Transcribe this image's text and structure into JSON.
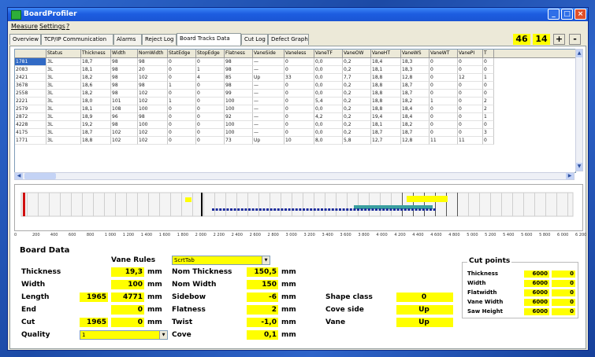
{
  "window": {
    "title": "BoardProfiler",
    "accent": "#1d5de0"
  },
  "menu": [
    "Measure",
    "Settings",
    "?"
  ],
  "tabs": [
    "Overview",
    "TCP/IP Communication",
    "Alarms",
    "Reject Log",
    "Board Tracks Data",
    "Cut Log",
    "Defect Graph"
  ],
  "active_tab": 4,
  "counters": {
    "a": "46",
    "b": "14"
  },
  "buttons": {
    "plus": "+",
    "minus": "-"
  },
  "grid": {
    "columns": [
      "",
      "Status",
      "Thickness",
      "Width",
      "NomWidth",
      "StatEdge",
      "StopEdge",
      "Flatness",
      "VaneSide",
      "Vaneless",
      "VaneTF",
      "VaneOW",
      "VaneHT",
      "VaneWS",
      "VaneWT",
      "VanePI",
      "T"
    ],
    "rows": [
      [
        "1781",
        "3L",
        "18,7",
        "98",
        "98",
        "0",
        "0",
        "98",
        "—",
        "0",
        "0,0",
        "0,2",
        "18,4",
        "18,3",
        "0",
        "0",
        "0"
      ],
      [
        "2083",
        "3L",
        "18,1",
        "98",
        "20",
        "0",
        "1",
        "98",
        "—",
        "0",
        "0,0",
        "0,2",
        "18,1",
        "18,3",
        "0",
        "0",
        "0"
      ],
      [
        "2421",
        "3L",
        "18,2",
        "98",
        "102",
        "0",
        "4",
        "85",
        "Up",
        "33",
        "0,0",
        "7,7",
        "18,8",
        "12,8",
        "0",
        "12",
        "1"
      ],
      [
        "3678",
        "3L",
        "18,6",
        "98",
        "98",
        "1",
        "0",
        "98",
        "—",
        "0",
        "0,0",
        "0,2",
        "18,8",
        "18,7",
        "0",
        "0",
        "0"
      ],
      [
        "2558",
        "3L",
        "18,2",
        "98",
        "102",
        "0",
        "0",
        "99",
        "—",
        "0",
        "0,0",
        "0,2",
        "18,8",
        "18,7",
        "0",
        "0",
        "0"
      ],
      [
        "2221",
        "3L",
        "18,0",
        "101",
        "102",
        "1",
        "0",
        "100",
        "—",
        "0",
        "5,4",
        "0,2",
        "18,8",
        "18,2",
        "1",
        "0",
        "2"
      ],
      [
        "2579",
        "3L",
        "18,1",
        "108",
        "100",
        "0",
        "0",
        "100",
        "—",
        "0",
        "0,0",
        "0,2",
        "18,8",
        "18,4",
        "0",
        "0",
        "2"
      ],
      [
        "2872",
        "3L",
        "18,9",
        "96",
        "98",
        "0",
        "0",
        "92",
        "—",
        "0",
        "4,2",
        "0,2",
        "19,4",
        "18,4",
        "0",
        "0",
        "1"
      ],
      [
        "4228",
        "3L",
        "19,2",
        "98",
        "100",
        "0",
        "0",
        "100",
        "—",
        "0",
        "0,0",
        "0,2",
        "18,1",
        "18,2",
        "0",
        "0",
        "0"
      ],
      [
        "4175",
        "3L",
        "18,7",
        "102",
        "102",
        "0",
        "0",
        "100",
        "—",
        "0",
        "0,0",
        "0,2",
        "18,7",
        "18,7",
        "0",
        "0",
        "3"
      ],
      [
        "1771",
        "3L",
        "18,8",
        "102",
        "102",
        "0",
        "0",
        "73",
        "Up",
        "10",
        "8,0",
        "5,8",
        "12,7",
        "12,8",
        "11",
        "11",
        "0"
      ]
    ]
  },
  "ruler": [
    "0",
    "200",
    "400",
    "600",
    "800",
    "1 000",
    "1 200",
    "1 400",
    "1 600",
    "1 800",
    "2 000",
    "2 200",
    "2 400",
    "2 600",
    "2 800",
    "3 000",
    "3 200",
    "3 400",
    "3 600",
    "3 800",
    "4 000",
    "4 200",
    "4 400",
    "4 600",
    "4 800",
    "5 000",
    "5 200",
    "5 400",
    "5 600",
    "5 800",
    "6 000",
    "6 200"
  ],
  "board": {
    "section_title": "Board Data",
    "vane_rules_label": "Vane Rules",
    "vane_rules_value": "ScrtTab",
    "thickness_label": "Thickness",
    "thickness_value": "19,3",
    "thickness_unit": "mm",
    "width_label": "Width",
    "width_value": "100",
    "width_unit": "mm",
    "length_label": "Length",
    "length_value1": "1965",
    "length_value2": "4771",
    "length_unit": "mm",
    "end_label": "End",
    "end_value": "0",
    "end_unit": "mm",
    "cut_label": "Cut",
    "cut_value1": "1965",
    "cut_value2": "0",
    "cut_unit": "mm",
    "quality_label": "Quality",
    "quality_value": "1",
    "nom_thickness_label": "Nom Thickness",
    "nom_thickness_value": "150,5",
    "nom_thickness_unit": "mm",
    "nom_width_label": "Nom Width",
    "nom_width_value": "150",
    "nom_width_unit": "mm",
    "sidebow_label": "Sidebow",
    "sidebow_value": "-6",
    "sidebow_unit": "mm",
    "flatness_label": "Flatness",
    "flatness_value": "2",
    "flatness_unit": "mm",
    "twist_label": "Twist",
    "twist_value": "-1,0",
    "twist_unit": "mm",
    "cove_label": "Cove",
    "cove_value": "0,1",
    "cove_unit": "mm",
    "shape_class_label": "Shape class",
    "shape_class_value": "0",
    "cove_side_label": "Cove side",
    "cove_side_value": "Up",
    "vane_label": "Vane",
    "vane_value": "Up"
  },
  "cutpoints": {
    "title": "Cut points",
    "items": [
      {
        "label": "Thickness",
        "v1": "6000",
        "v2": "0"
      },
      {
        "label": "Width",
        "v1": "6000",
        "v2": "0"
      },
      {
        "label": "Flatwidth",
        "v1": "6000",
        "v2": "0"
      },
      {
        "label": "Vane Width",
        "v1": "6000",
        "v2": "0"
      },
      {
        "label": "Saw Height",
        "v1": "6000",
        "v2": "0"
      }
    ]
  }
}
